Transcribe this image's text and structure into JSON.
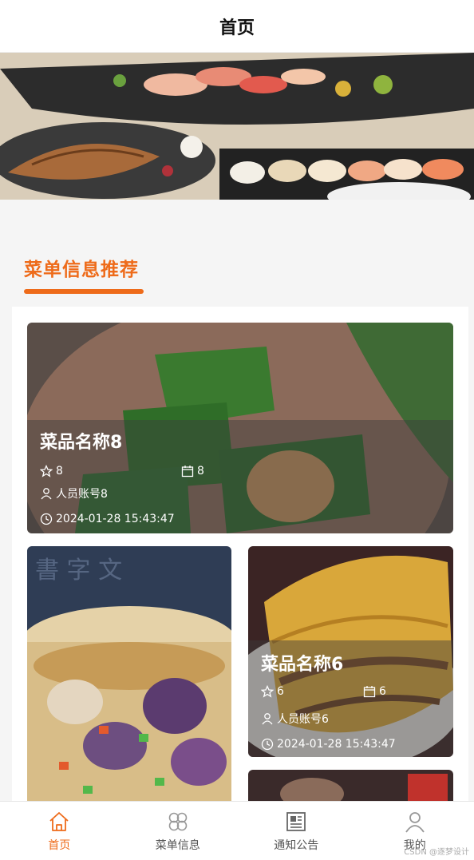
{
  "header": {
    "title": "首页"
  },
  "banner": {
    "icon": "food-banner-image",
    "dots": 1
  },
  "section": {
    "title": "菜单信息推荐"
  },
  "cards": [
    {
      "name": "菜品名称8",
      "likes": "8",
      "calendar": "8",
      "account": "人员账号8",
      "time": "2024-01-28 15:43:47"
    },
    {
      "name": "菜品名称6",
      "likes": "6",
      "calendar": "6",
      "account": "人员账号6",
      "time": "2024-01-28 15:43:47"
    }
  ],
  "tabbar": {
    "items": [
      {
        "label": "首页",
        "icon": "home-icon",
        "active": true
      },
      {
        "label": "菜单信息",
        "icon": "grid-icon",
        "active": false
      },
      {
        "label": "通知公告",
        "icon": "news-icon",
        "active": false
      },
      {
        "label": "我的",
        "icon": "user-icon",
        "active": false
      }
    ]
  },
  "watermark": "CSDN @逐梦设计",
  "colors": {
    "accent": "#ee6b1a",
    "background": "#f5f5f5"
  }
}
